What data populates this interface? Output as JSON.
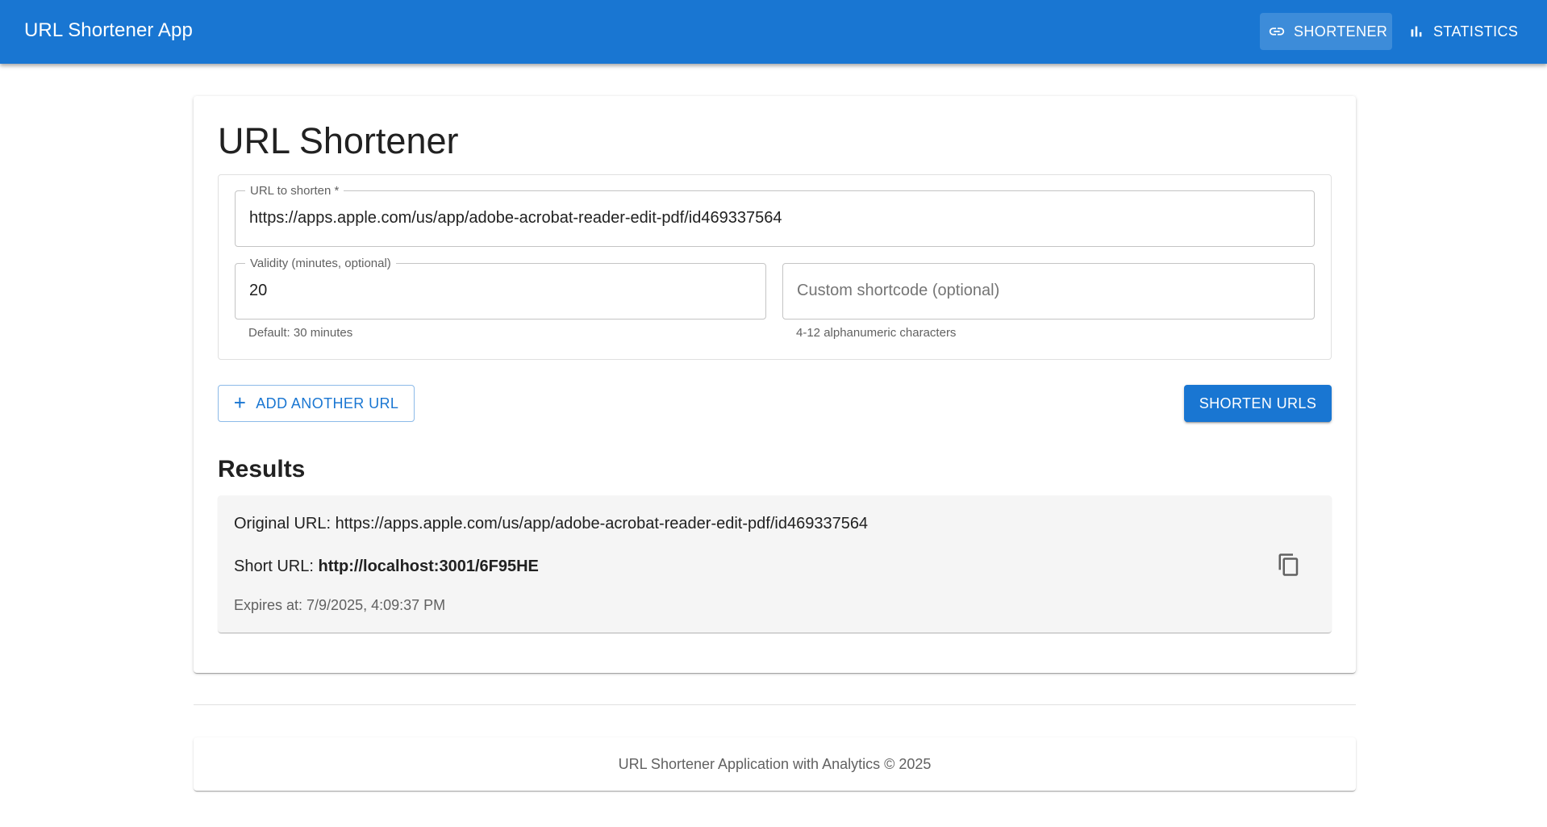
{
  "appbar": {
    "title": "URL Shortener App",
    "nav": [
      {
        "label": "SHORTENER",
        "icon": "link-icon",
        "active": true
      },
      {
        "label": "STATISTICS",
        "icon": "bar-chart-icon",
        "active": false
      }
    ],
    "color": "#1976d2"
  },
  "main": {
    "title": "URL Shortener",
    "url_field": {
      "label": "URL to shorten *",
      "value": "https://apps.apple.com/us/app/adobe-acrobat-reader-edit-pdf/id469337564"
    },
    "validity_field": {
      "label": "Validity (minutes, optional)",
      "value": "20",
      "helper": "Default: 30 minutes"
    },
    "shortcode_field": {
      "placeholder": "Custom shortcode (optional)",
      "value": "",
      "helper": "4-12 alphanumeric characters"
    },
    "add_button": "ADD ANOTHER URL",
    "shorten_button": "SHORTEN URLS"
  },
  "results": {
    "title": "Results",
    "items": [
      {
        "original_label": "Original URL: ",
        "original_url": "https://apps.apple.com/us/app/adobe-acrobat-reader-edit-pdf/id469337564",
        "short_label": "Short URL: ",
        "short_url": "http://localhost:3001/6F95HE",
        "expires": "Expires at: 7/9/2025, 4:09:37 PM",
        "copy_icon": "copy-icon"
      }
    ]
  },
  "footer": {
    "text": "URL Shortener Application with Analytics © 2025"
  }
}
